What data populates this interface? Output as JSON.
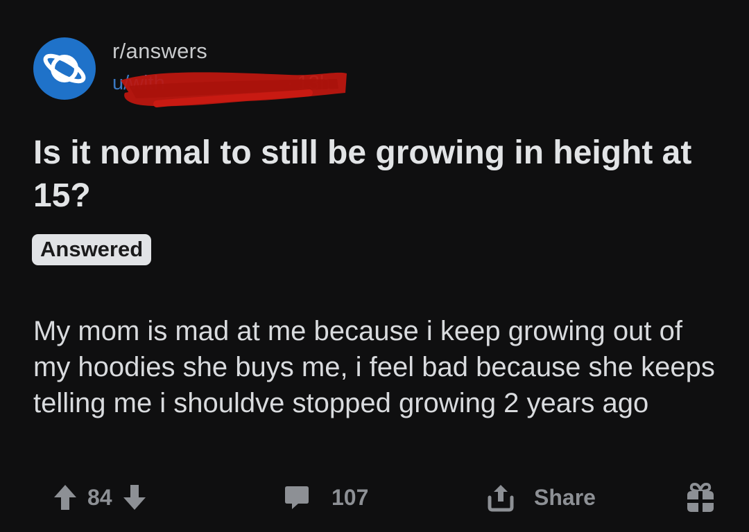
{
  "post": {
    "subreddit": "r/answers",
    "username": "u/with",
    "age": "13h",
    "title": "Is it normal to still be growing in height at 15?",
    "flair": "Answered",
    "body": "My mom is mad at me because i keep growing out of my hoodies she buys me, i feel bad because she keeps telling me i shouldve stopped growing 2 years ago"
  },
  "actions": {
    "upvotes": "84",
    "comments": "107",
    "share_label": "Share"
  },
  "icons": {
    "avatar": "planet-icon",
    "upvote": "arrow-up-icon",
    "downvote": "arrow-down-icon",
    "comments": "comment-bubble-icon",
    "share": "share-upload-icon",
    "award": "gift-icon"
  },
  "colors": {
    "background": "#0f0f10",
    "avatar_blue": "#1f72c9",
    "flair_bg": "#e1e3e6",
    "redaction": "#c0170f"
  }
}
